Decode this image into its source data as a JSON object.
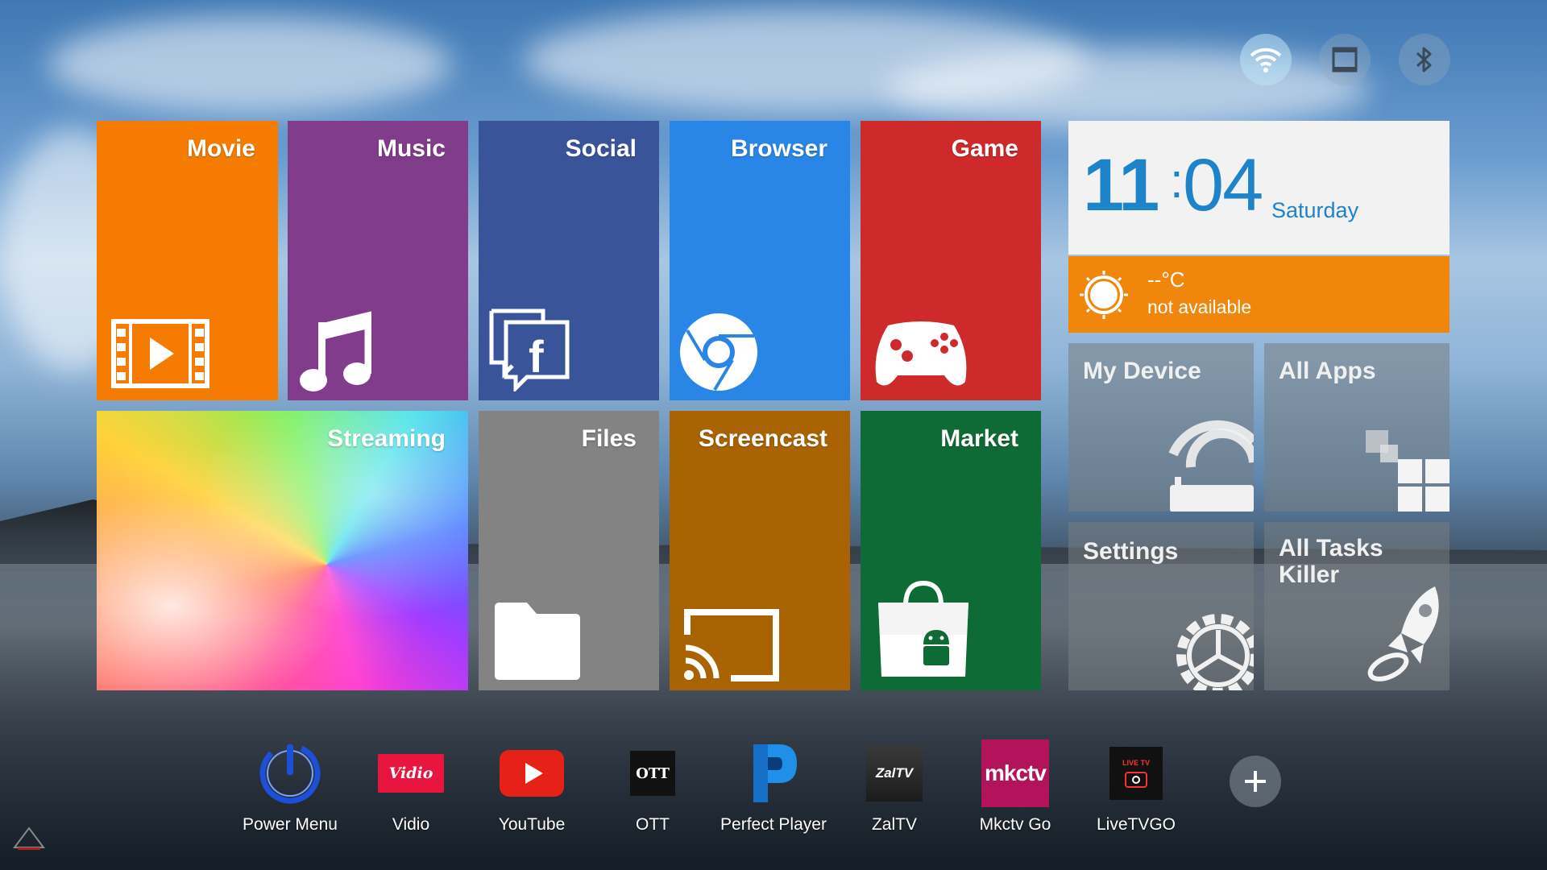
{
  "tiles": {
    "movie": "Movie",
    "music": "Music",
    "social": "Social",
    "browser": "Browser",
    "game": "Game",
    "streaming": "Streaming",
    "files": "Files",
    "screencast": "Screencast",
    "market": "Market"
  },
  "clock": {
    "hour": "11",
    "separator": ":",
    "minute": "04",
    "day": "Saturday"
  },
  "weather": {
    "temperature": "--°C",
    "status": "not available"
  },
  "system_tiles": {
    "my_device": "My Device",
    "all_apps": "All Apps",
    "settings": "Settings",
    "all_tasks_killer": "All Tasks Killer"
  },
  "dock": [
    {
      "label": "Power Menu",
      "icon": "power-icon"
    },
    {
      "label": "Vidio",
      "icon": "vidio-logo-icon",
      "logo_text": "Vidio"
    },
    {
      "label": "YouTube",
      "icon": "youtube-icon"
    },
    {
      "label": "OTT",
      "icon": "ott-logo-icon",
      "logo_text": "OTT"
    },
    {
      "label": "Perfect Player",
      "icon": "perfect-player-icon"
    },
    {
      "label": "ZalTV",
      "icon": "zaltv-logo-icon",
      "logo_text": "ZalTV"
    },
    {
      "label": "Mkctv Go",
      "icon": "mkctv-logo-icon",
      "logo_text": "mkctv"
    },
    {
      "label": "LiveTVGO",
      "icon": "livetvgo-logo-icon",
      "logo_text": "LIVE TV"
    }
  ],
  "status_icons": [
    "wifi-icon",
    "screen-icon",
    "bluetooth-icon"
  ],
  "colors": {
    "movie": "#f57c00",
    "music": "#813d8b",
    "social": "#3a5499",
    "browser": "#2a86e6",
    "game": "#cf2a2b",
    "files": "#838383",
    "screencast": "#a96303",
    "market": "#0f6b36",
    "weather": "#f0860b",
    "clock_text": "#1f83c9"
  }
}
